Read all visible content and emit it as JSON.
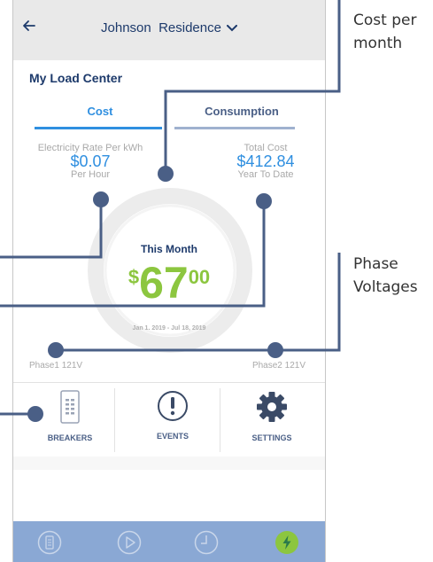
{
  "header": {
    "title": "Johnson  Residence"
  },
  "load_center": {
    "title": "My Load Center",
    "tabs": [
      {
        "label": "Cost"
      },
      {
        "label": "Consumption"
      }
    ],
    "rate": {
      "label": "Electricity Rate Per kWh",
      "value": "$0.07",
      "sub": "Per Hour"
    },
    "total": {
      "label": "Total Cost",
      "value": "$412.84",
      "sub": "Year To Date"
    },
    "gauge": {
      "label": "This Month",
      "symbol": "$",
      "whole": "67",
      "cents": "00",
      "range": "Jan 1. 2019 - Jul 18, 2019"
    },
    "phases": [
      {
        "label": "Phase1 121V"
      },
      {
        "label": "Phase2 121V"
      }
    ]
  },
  "actions": [
    {
      "label": "BREAKERS",
      "icon": "breaker-panel-icon"
    },
    {
      "label": "EVENTS",
      "icon": "exclamation-icon"
    },
    {
      "label": "SETTINGS",
      "icon": "gear-icon"
    }
  ],
  "bottom_nav": [
    "panel-icon",
    "play-icon",
    "clock-icon",
    "power-icon"
  ],
  "callouts": {
    "cost": "Cost per month",
    "phase": "Phase Voltages"
  },
  "colors": {
    "accent": "#2f8fe0",
    "amount": "#8cc63f",
    "nav": "#8aa8d4",
    "title": "#1d3a6b",
    "callout_line": "#4a5f86"
  }
}
